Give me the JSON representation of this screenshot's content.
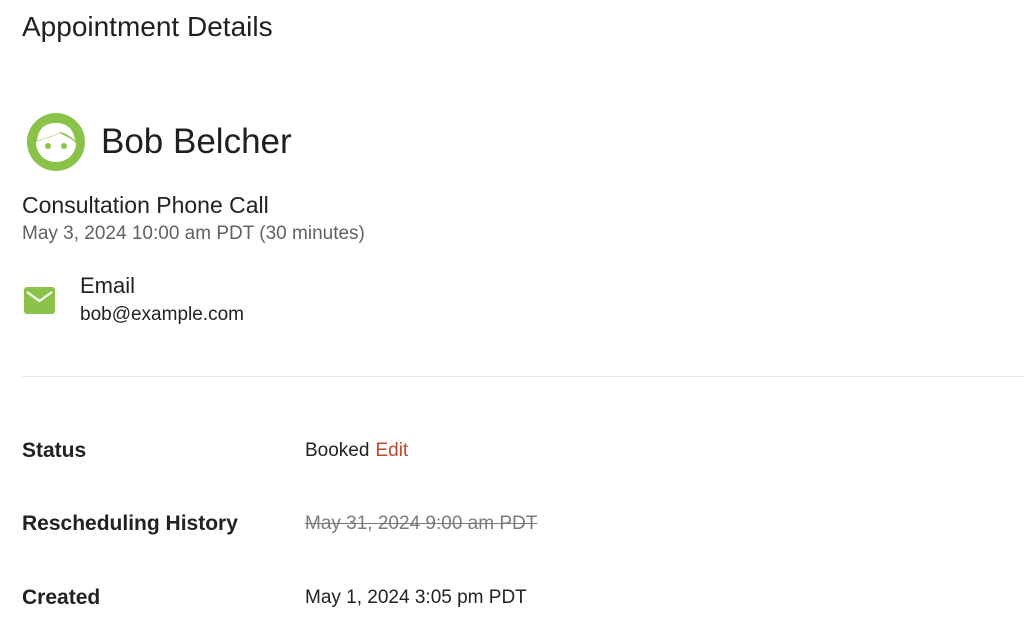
{
  "page": {
    "title": "Appointment Details"
  },
  "customer": {
    "name": "Bob Belcher",
    "avatar_icon": "face-avatar-icon",
    "avatar_color": "#8bc34a"
  },
  "appointment": {
    "service": "Consultation Phone Call",
    "when": "May 3, 2024 10:00 am PDT (30 minutes)"
  },
  "contact": {
    "icon": "mail-icon",
    "label": "Email",
    "value": "bob@example.com"
  },
  "details": {
    "status": {
      "label": "Status",
      "value": "Booked",
      "edit_label": "Edit"
    },
    "rescheduling": {
      "label": "Rescheduling History",
      "value": "May 31, 2024 9:00 am PDT"
    },
    "created": {
      "label": "Created",
      "value": "May 1, 2024 3:05 pm PDT"
    }
  },
  "colors": {
    "accent": "#8bc34a",
    "link": "#c0482e",
    "muted": "#616161"
  }
}
